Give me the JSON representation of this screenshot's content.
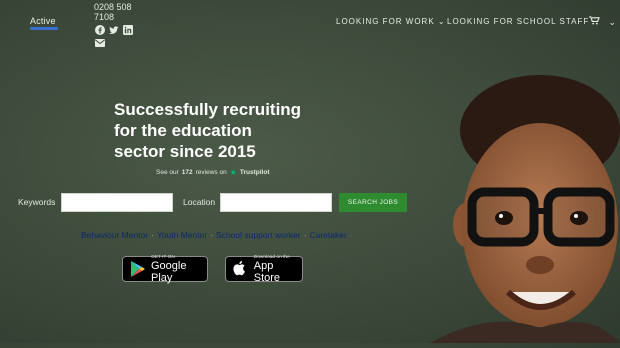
{
  "header": {
    "logo_text": "Active",
    "phone": "0208 508 7108",
    "nav": {
      "looking_for_work": "LOOKING FOR WORK",
      "looking_for_school_staff": "LOOKING FOR SCHOOL STAFF"
    }
  },
  "hero": {
    "headline_line1": "Successfully recruiting",
    "headline_line2": "for the education",
    "headline_line3": "sector since 2015",
    "reviews_prefix": "See our",
    "reviews_count": "172",
    "reviews_suffix": "reviews on",
    "trustpilot": "Trustpilot"
  },
  "search": {
    "keywords_label": "Keywords",
    "location_label": "Location",
    "button_label": "SEARCH JOBS"
  },
  "roles": [
    "Behaviour Mentor",
    "Youth Mentor",
    "School support worker",
    "Caretaker"
  ],
  "stores": {
    "google_small": "GET IT ON",
    "google_big": "Google Play",
    "apple_small": "Download on the",
    "apple_big": "App Store"
  },
  "colors": {
    "background": "#3f4b3d",
    "search_button": "#2e8b2f",
    "role_links": "#0b2a6e",
    "trustpilot_star": "#00b67a"
  }
}
